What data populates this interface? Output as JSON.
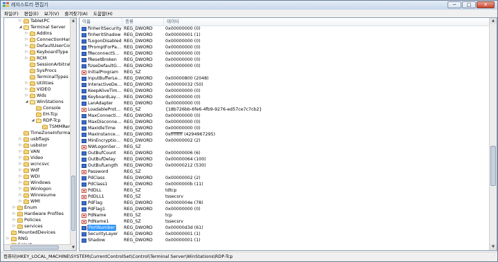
{
  "window": {
    "title": "레지스트리 편집기",
    "minimize": "─",
    "maximize": "□",
    "close": "✕"
  },
  "menu": [
    "파일(F)",
    "편집(E)",
    "보기(V)",
    "즐겨찾기(A)",
    "도움말(H)"
  ],
  "tree": [
    {
      "label": "TabletPC",
      "level": 4,
      "expander": "plus"
    },
    {
      "label": "Terminal Server",
      "level": 4,
      "expander": "minus",
      "open": true
    },
    {
      "label": "AddIns",
      "level": 5,
      "expander": "plus"
    },
    {
      "label": "ConnectionHandler",
      "level": 5,
      "expander": "plus"
    },
    {
      "label": "DefaultUserConfiguration",
      "level": 5,
      "expander": "plus"
    },
    {
      "label": "KeyboardType Mapping",
      "level": 5,
      "expander": "plus"
    },
    {
      "label": "RCM",
      "level": 5,
      "expander": "plus"
    },
    {
      "label": "SessionArbitrationHelper",
      "level": 5,
      "expander": "none"
    },
    {
      "label": "SysProcs",
      "level": 5,
      "expander": "none"
    },
    {
      "label": "TerminalTypes",
      "level": 5,
      "expander": "none"
    },
    {
      "label": "Utilities",
      "level": 5,
      "expander": "plus"
    },
    {
      "label": "VIDEO",
      "level": 5,
      "expander": "plus"
    },
    {
      "label": "Wds",
      "level": 5,
      "expander": "plus"
    },
    {
      "label": "WinStations",
      "level": 5,
      "expander": "minus",
      "open": true
    },
    {
      "label": "Console",
      "level": 6,
      "expander": "none"
    },
    {
      "label": "EH-Tcp",
      "level": 6,
      "expander": "none"
    },
    {
      "label": "RDP-Tcp",
      "level": 6,
      "expander": "minus",
      "open": true
    },
    {
      "label": "TSMMRemotingAllowedApps",
      "level": 7,
      "expander": "none"
    },
    {
      "label": "TimeZoneInformation",
      "level": 4,
      "expander": "none"
    },
    {
      "label": "usbflags",
      "level": 4,
      "expander": "plus"
    },
    {
      "label": "usbstor",
      "level": 4,
      "expander": "plus"
    },
    {
      "label": "VAN",
      "level": 4,
      "expander": "plus"
    },
    {
      "label": "Video",
      "level": 4,
      "expander": "plus"
    },
    {
      "label": "wcncsvc",
      "level": 4,
      "expander": "plus"
    },
    {
      "label": "Wdf",
      "level": 4,
      "expander": "plus"
    },
    {
      "label": "WDI",
      "level": 4,
      "expander": "plus"
    },
    {
      "label": "Windows",
      "level": 4,
      "expander": "plus"
    },
    {
      "label": "Winlogon",
      "level": 4,
      "expander": "plus"
    },
    {
      "label": "Winresume",
      "level": 4,
      "expander": "plus"
    },
    {
      "label": "WMI",
      "level": 4,
      "expander": "plus"
    },
    {
      "label": "Enum",
      "level": 3,
      "expander": "plus"
    },
    {
      "label": "Hardware Profiles",
      "level": 3,
      "expander": "plus"
    },
    {
      "label": "Policies",
      "level": 3,
      "expander": "plus"
    },
    {
      "label": "services",
      "level": 3,
      "expander": "plus"
    },
    {
      "label": "MountedDevices",
      "level": 2,
      "expander": "none"
    },
    {
      "label": "RNG",
      "level": 2,
      "expander": "plus"
    },
    {
      "label": "Select",
      "level": 2,
      "expander": "none"
    }
  ],
  "list": {
    "headers": {
      "name": "이름",
      "type": "종류",
      "data": "데이터"
    },
    "rows": [
      {
        "name": "fInheritSecurity",
        "type": "REG_DWORD",
        "data": "0x00000000 (0)",
        "icon": "bin"
      },
      {
        "name": "fInheritShadow",
        "type": "REG_DWORD",
        "data": "0x00000001 (1)",
        "icon": "bin"
      },
      {
        "name": "fLogonDisabled",
        "type": "REG_DWORD",
        "data": "0x00000000 (0)",
        "icon": "bin"
      },
      {
        "name": "fPromptForPassword",
        "type": "REG_DWORD",
        "data": "0x00000000 (0)",
        "icon": "bin"
      },
      {
        "name": "fReconnectSame",
        "type": "REG_DWORD",
        "data": "0x00000000 (0)",
        "icon": "bin"
      },
      {
        "name": "fResetBroken",
        "type": "REG_DWORD",
        "data": "0x00000000 (0)",
        "icon": "bin"
      },
      {
        "name": "fUseDefaultGina",
        "type": "REG_DWORD",
        "data": "0x00000000 (0)",
        "icon": "bin"
      },
      {
        "name": "InitialProgram",
        "type": "REG_SZ",
        "data": "",
        "icon": "str"
      },
      {
        "name": "InputBufferLength",
        "type": "REG_DWORD",
        "data": "0x00000800 (2048)",
        "icon": "bin"
      },
      {
        "name": "InteractiveDelay",
        "type": "REG_DWORD",
        "data": "0x00000032 (50)",
        "icon": "bin"
      },
      {
        "name": "KeepAliveTimeout",
        "type": "REG_DWORD",
        "data": "0x00000000 (0)",
        "icon": "bin"
      },
      {
        "name": "KeyboardLayout",
        "type": "REG_DWORD",
        "data": "0x00000000 (0)",
        "icon": "bin"
      },
      {
        "name": "LanAdapter",
        "type": "REG_DWORD",
        "data": "0x00000000 (0)",
        "icon": "bin"
      },
      {
        "name": "LoadableProtocol_Object",
        "type": "REG_SZ",
        "data": "{18b726bb-6fe6-4fb9-9276-ed57ce7c7cb2}",
        "icon": "str"
      },
      {
        "name": "MaxConnectionTime",
        "type": "REG_DWORD",
        "data": "0x00000000 (0)",
        "icon": "bin"
      },
      {
        "name": "MaxDisconnectionTime",
        "type": "REG_DWORD",
        "data": "0x00000000 (0)",
        "icon": "bin"
      },
      {
        "name": "MaxIdleTime",
        "type": "REG_DWORD",
        "data": "0x00000000 (0)",
        "icon": "bin"
      },
      {
        "name": "MaxInstanceCount",
        "type": "REG_DWORD",
        "data": "0xffffffff (4294967295)",
        "icon": "bin"
      },
      {
        "name": "MinEncryptionLevel",
        "type": "REG_DWORD",
        "data": "0x00000002 (2)",
        "icon": "bin"
      },
      {
        "name": "NWLogonServer",
        "type": "REG_SZ",
        "data": "",
        "icon": "str"
      },
      {
        "name": "OutBufCount",
        "type": "REG_DWORD",
        "data": "0x00000006 (6)",
        "icon": "bin"
      },
      {
        "name": "OutBufDelay",
        "type": "REG_DWORD",
        "data": "0x00000064 (100)",
        "icon": "bin"
      },
      {
        "name": "OutBufLength",
        "type": "REG_DWORD",
        "data": "0x00000212 (530)",
        "icon": "bin"
      },
      {
        "name": "Password",
        "type": "REG_SZ",
        "data": "",
        "icon": "str"
      },
      {
        "name": "PdClass",
        "type": "REG_DWORD",
        "data": "0x00000002 (2)",
        "icon": "bin"
      },
      {
        "name": "PdClass1",
        "type": "REG_DWORD",
        "data": "0x0000000b (11)",
        "icon": "bin"
      },
      {
        "name": "PdDLL",
        "type": "REG_SZ",
        "data": "tdtcp",
        "icon": "str"
      },
      {
        "name": "PdDLL1",
        "type": "REG_SZ",
        "data": "tssecsrv",
        "icon": "str"
      },
      {
        "name": "PdFlag",
        "type": "REG_DWORD",
        "data": "0x0000004e (78)",
        "icon": "bin"
      },
      {
        "name": "PdFlag1",
        "type": "REG_DWORD",
        "data": "0x00000000 (0)",
        "icon": "bin"
      },
      {
        "name": "PdName",
        "type": "REG_SZ",
        "data": "tcp",
        "icon": "str"
      },
      {
        "name": "PdName1",
        "type": "REG_SZ",
        "data": "tssecsrv",
        "icon": "str"
      },
      {
        "name": "PortNumber",
        "type": "REG_DWORD",
        "data": "0x00000d3d (61)",
        "icon": "bin",
        "selected": true
      },
      {
        "name": "SecurityLayer",
        "type": "REG_DWORD",
        "data": "0x00000001 (1)",
        "icon": "bin"
      },
      {
        "name": "Shadow",
        "type": "REG_DWORD",
        "data": "0x00000001 (1)",
        "icon": "bin"
      }
    ]
  },
  "status": "컴퓨터\\HKEY_LOCAL_MACHINE\\SYSTEM\\CurrentControlSet\\Control\\Terminal Server\\WinStations\\RDP-Tcp",
  "colors": {
    "selection": "#3399ff",
    "titlebar": "#c7d7ea"
  }
}
